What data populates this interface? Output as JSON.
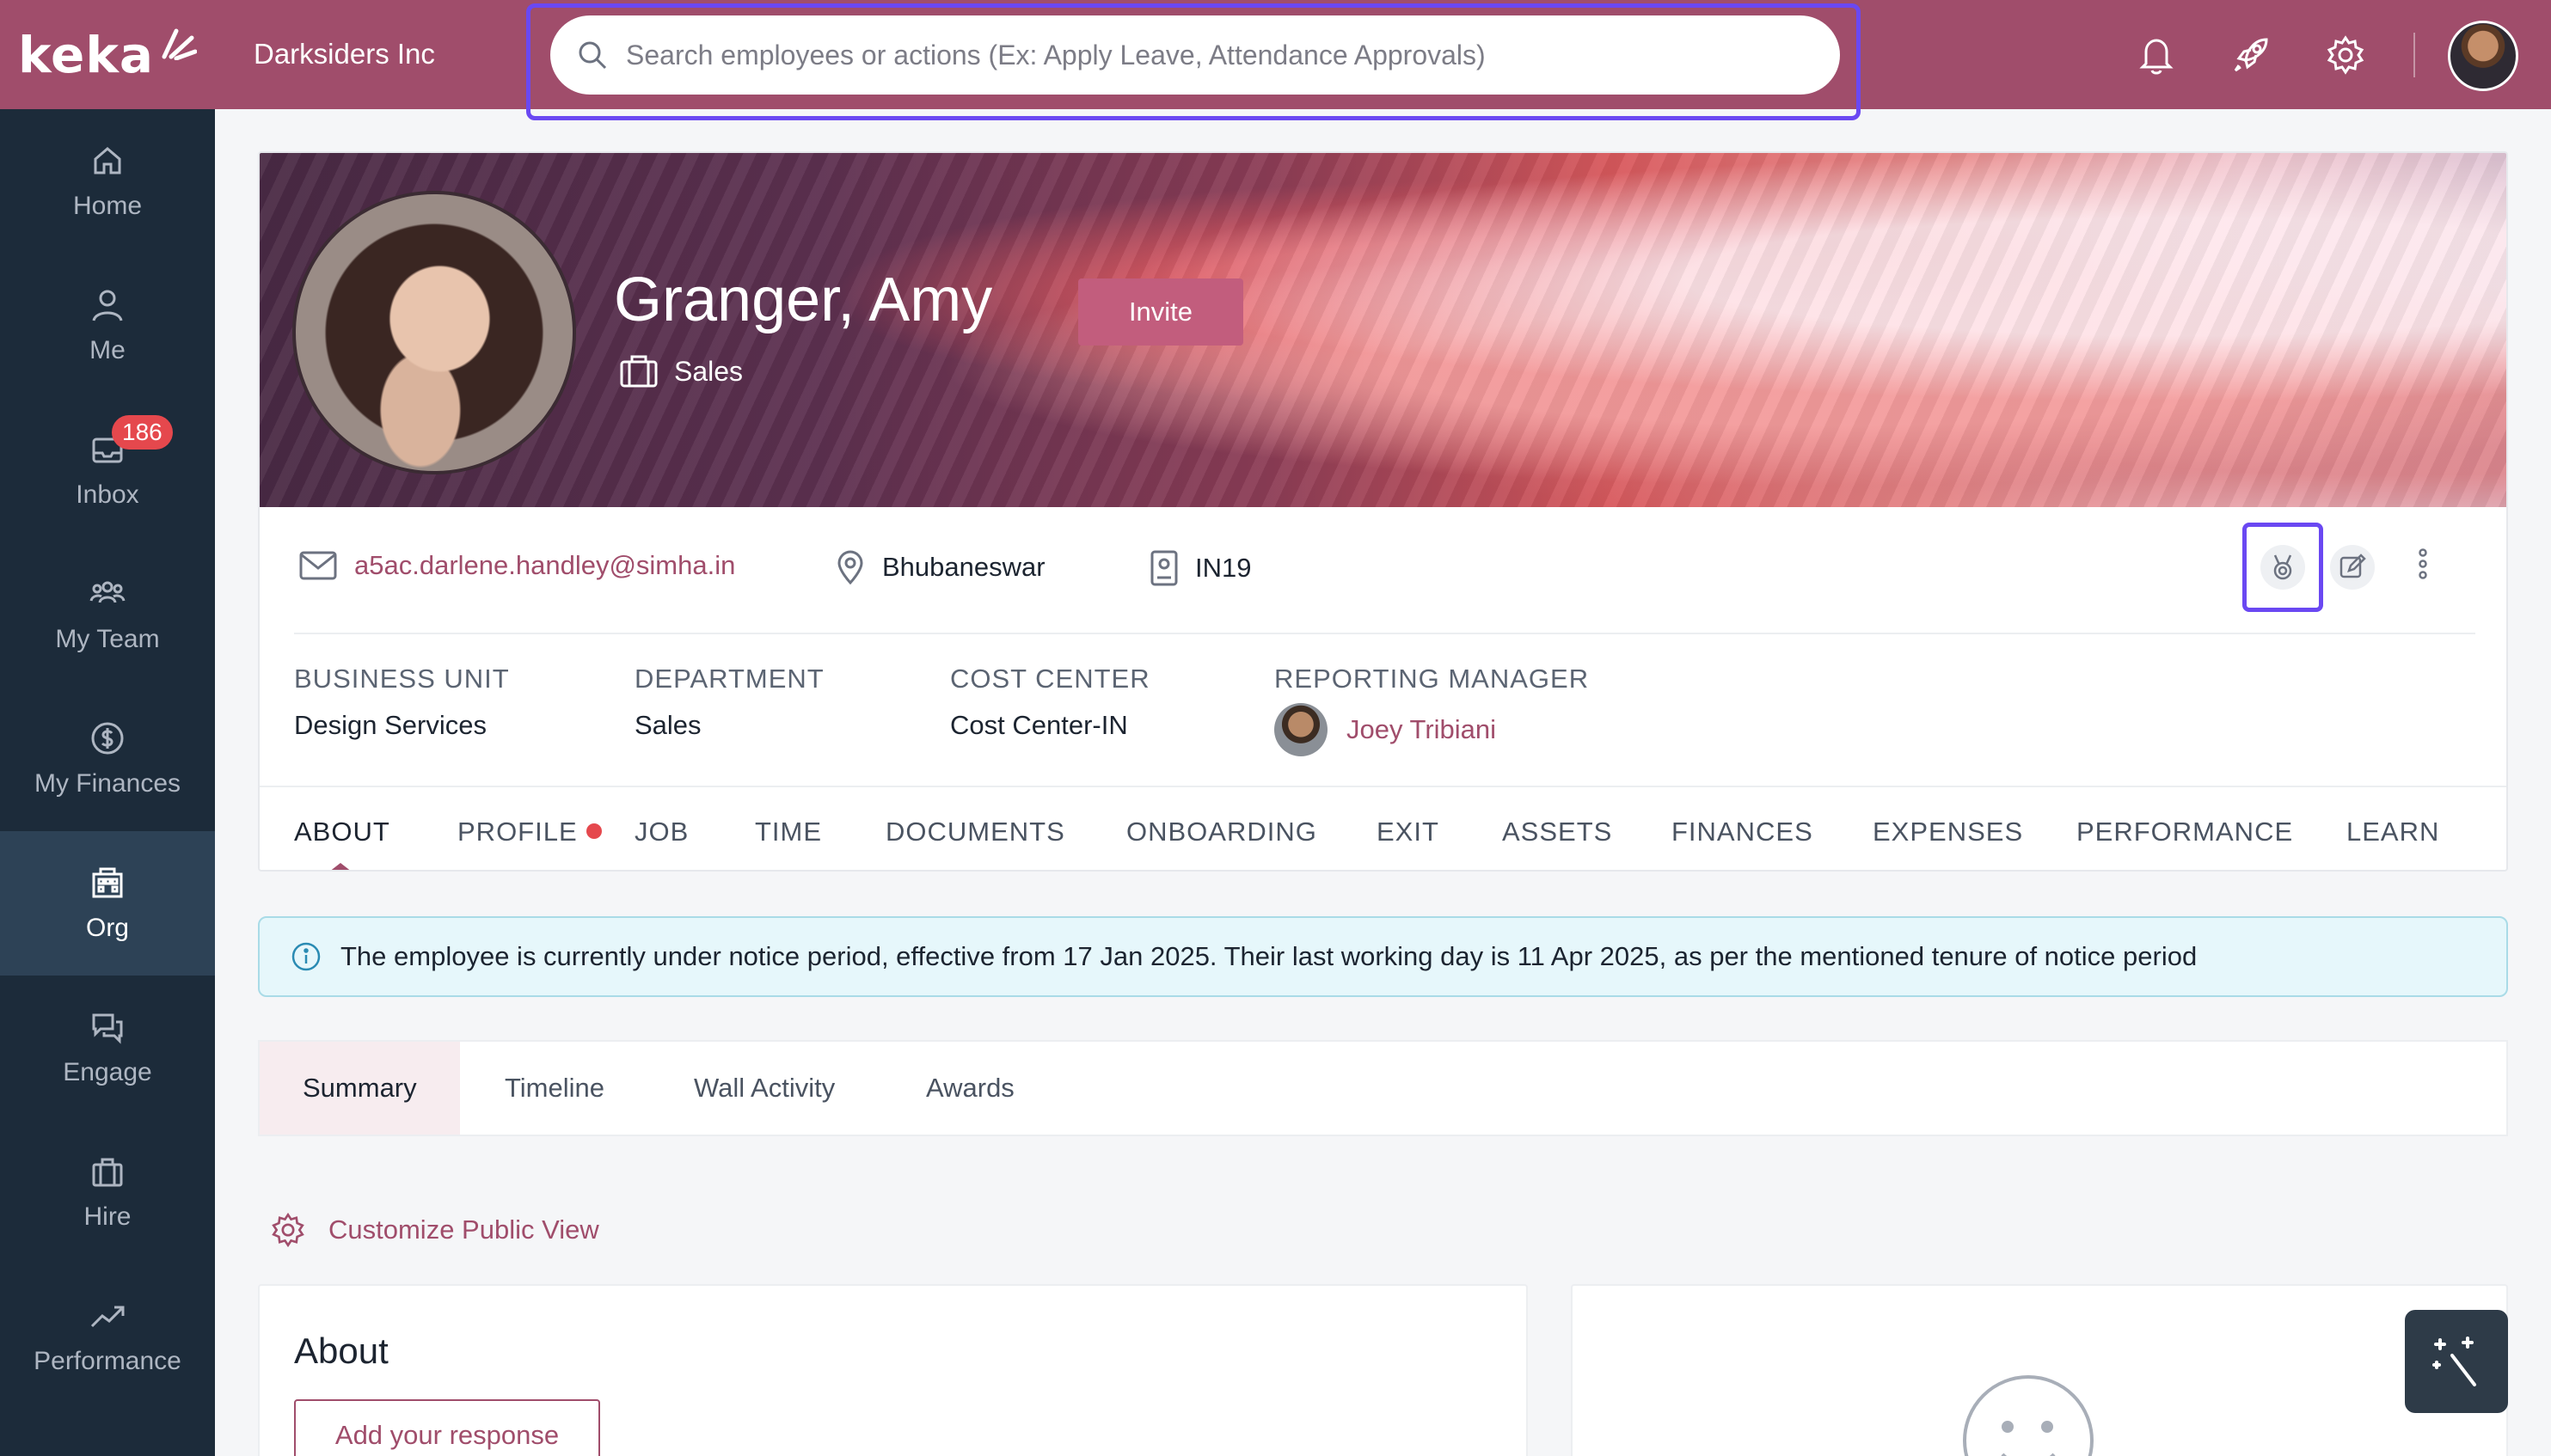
{
  "app": {
    "logo_text": "keka",
    "company": "Darksiders Inc"
  },
  "search": {
    "placeholder": "Search employees or actions (Ex: Apply Leave, Attendance Approvals)"
  },
  "sidebar": {
    "items": [
      {
        "label": "Home",
        "icon": "home-icon"
      },
      {
        "label": "Me",
        "icon": "user-icon"
      },
      {
        "label": "Inbox",
        "icon": "inbox-icon",
        "badge": "186"
      },
      {
        "label": "My Team",
        "icon": "team-icon"
      },
      {
        "label": "My Finances",
        "icon": "dollar-icon"
      },
      {
        "label": "Org",
        "icon": "building-icon",
        "active": true
      },
      {
        "label": "Engage",
        "icon": "chat-icon"
      },
      {
        "label": "Hire",
        "icon": "briefcase-icon"
      },
      {
        "label": "Performance",
        "icon": "trend-icon"
      }
    ]
  },
  "employee": {
    "name": "Granger, Amy",
    "department": "Sales",
    "invite_label": "Invite",
    "email": "a5ac.darlene.handley@simha.in",
    "location": "Bhubaneswar",
    "employee_id": "IN19"
  },
  "meta": {
    "business_unit_label": "BUSINESS UNIT",
    "business_unit": "Design Services",
    "department_label": "DEPARTMENT",
    "department": "Sales",
    "cost_center_label": "COST CENTER",
    "cost_center": "Cost Center-IN",
    "manager_label": "REPORTING MANAGER",
    "manager": "Joey Tribiani"
  },
  "tabs": [
    "ABOUT",
    "PROFILE",
    "JOB",
    "TIME",
    "DOCUMENTS",
    "ONBOARDING",
    "EXIT",
    "ASSETS",
    "FINANCES",
    "EXPENSES",
    "PERFORMANCE",
    "LEARN"
  ],
  "notice": "The employee is currently under notice period, effective from 17 Jan 2025. Their last working day is 11 Apr 2025, as per the mentioned tenure of notice period",
  "subtabs": [
    "Summary",
    "Timeline",
    "Wall Activity",
    "Awards"
  ],
  "customize_label": "Customize Public View",
  "about": {
    "title": "About",
    "add_response_label": "Add your response"
  },
  "colors": {
    "brand": "#a04d6b",
    "sidebar": "#1c2b3a",
    "highlight": "#6a48f2",
    "badge": "#e5484d"
  }
}
